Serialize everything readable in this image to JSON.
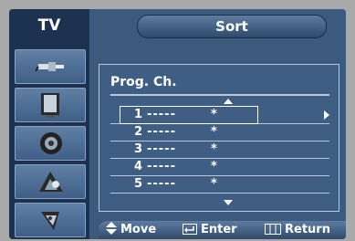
{
  "header": {
    "tv_label": "TV",
    "title": "Sort"
  },
  "sidebar": {
    "items": [
      {
        "icon": "antenna-plug-icon"
      },
      {
        "icon": "monitor-icon"
      },
      {
        "icon": "speaker-icon"
      },
      {
        "icon": "channel-setup-icon"
      },
      {
        "icon": "setup-tools-icon"
      }
    ]
  },
  "panel": {
    "header": "Prog.  Ch.",
    "rows": [
      {
        "num": "1",
        "name": "-----",
        "star": "*"
      },
      {
        "num": "2",
        "name": "-----",
        "star": "*"
      },
      {
        "num": "3",
        "name": "-----",
        "star": "*"
      },
      {
        "num": "4",
        "name": "-----",
        "star": "*"
      },
      {
        "num": "5",
        "name": "-----",
        "star": "*"
      }
    ],
    "selected_index": 0
  },
  "footer": {
    "move": "Move",
    "enter": "Enter",
    "return": "Return"
  }
}
